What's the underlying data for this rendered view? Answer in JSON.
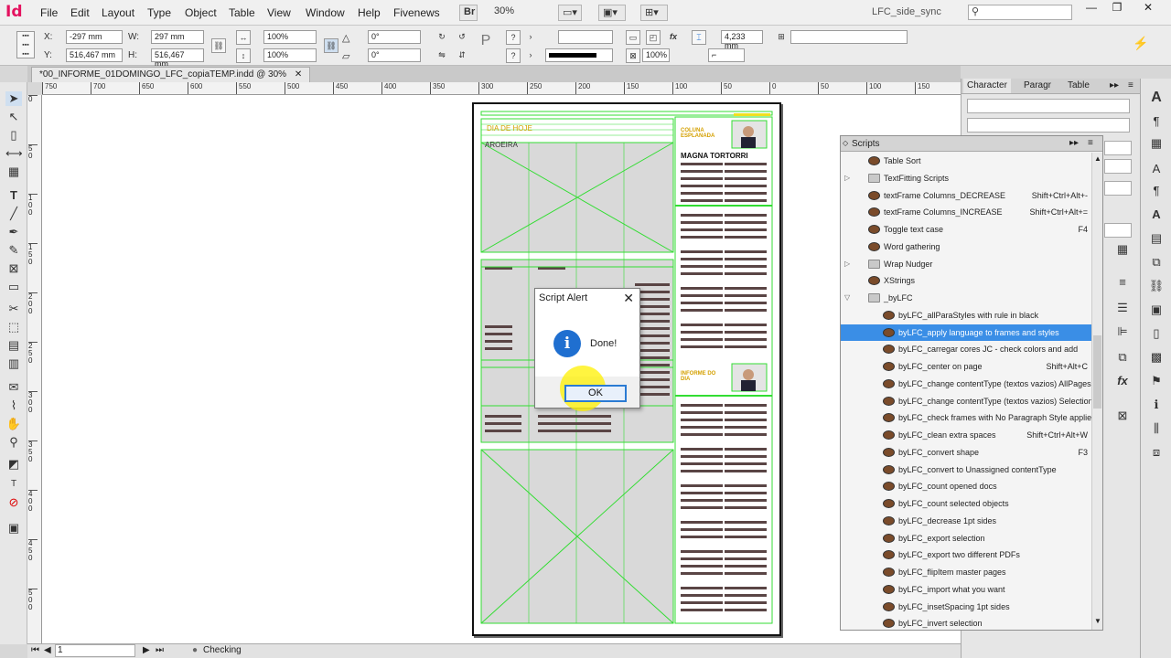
{
  "app": {
    "logo": "Id",
    "workspace": "LFC_side_sync",
    "zoom": "30%",
    "bridge_label": "Br"
  },
  "menu": [
    "File",
    "Edit",
    "Layout",
    "Type",
    "Object",
    "Table",
    "View",
    "Window",
    "Help",
    "Fivenews"
  ],
  "control": {
    "x_label": "X:",
    "x_value": "-297 mm",
    "y_label": "Y:",
    "y_value": "516,467 mm",
    "w_label": "W:",
    "w_value": "297 mm",
    "h_label": "H:",
    "h_value": "516,467 mm",
    "scale_x": "100%",
    "scale_y": "100%",
    "rotate": "0°",
    "shear": "0°",
    "stroke_weight": "4,233 mm",
    "opacity": "100%"
  },
  "doc_tab": "*00_INFORME_01DOMINGO_LFC_copiaTEMP.indd @ 30%",
  "ruler_h": [
    "750",
    "700",
    "650",
    "600",
    "550",
    "500",
    "450",
    "400",
    "350",
    "300",
    "250",
    "200",
    "150",
    "100",
    "50",
    "0",
    "50",
    "100",
    "150"
  ],
  "ruler_v": [
    "0",
    "5 0",
    "1 0 0",
    "1 5 0",
    "2 0 0",
    "2 5 0",
    "3 0 0",
    "3 5 0",
    "4 0 0",
    "4 5 0",
    "5 0 0"
  ],
  "page_texts": {
    "head1": "DIA DE HOJE",
    "head2": "AROEIRA",
    "col_title": "COLUNA ESPLANADA",
    "author": "MAGNA TORTORRI",
    "informe": "INFORME DO DIA"
  },
  "dialog": {
    "title": "Script Alert",
    "message": "Done!",
    "ok": "OK",
    "close": "✕",
    "info": "i"
  },
  "status": {
    "page": "1",
    "preflight": "Checking"
  },
  "char_panel": {
    "tab_character": "Character",
    "tab_paragraph": "Paragr",
    "tab_table": "Table"
  },
  "scripts_panel": {
    "title": "Scripts",
    "items": [
      {
        "label": "Table Sort",
        "shortcut": "",
        "kind": "script",
        "indent": 1,
        "twisty": ""
      },
      {
        "label": "TextFitting Scripts",
        "shortcut": "",
        "kind": "folder",
        "indent": 1,
        "twisty": "▷"
      },
      {
        "label": "textFrame Columns_DECREASE",
        "shortcut": "Shift+Ctrl+Alt+-",
        "kind": "script",
        "indent": 1,
        "twisty": ""
      },
      {
        "label": "textFrame Columns_INCREASE",
        "shortcut": "Shift+Ctrl+Alt+=",
        "kind": "script",
        "indent": 1,
        "twisty": ""
      },
      {
        "label": "Toggle text case",
        "shortcut": "F4",
        "kind": "script",
        "indent": 1,
        "twisty": ""
      },
      {
        "label": "Word gathering",
        "shortcut": "",
        "kind": "script",
        "indent": 1,
        "twisty": ""
      },
      {
        "label": "Wrap Nudger",
        "shortcut": "",
        "kind": "folder",
        "indent": 1,
        "twisty": "▷"
      },
      {
        "label": "XStrings",
        "shortcut": "",
        "kind": "script",
        "indent": 1,
        "twisty": ""
      },
      {
        "label": "_byLFC",
        "shortcut": "",
        "kind": "folder",
        "indent": 1,
        "twisty": "▽"
      },
      {
        "label": "byLFC_allParaStyles with rule in black",
        "shortcut": "",
        "kind": "script",
        "indent": 2,
        "twisty": ""
      },
      {
        "label": "byLFC_apply language to frames and styles",
        "shortcut": "",
        "kind": "script",
        "indent": 2,
        "twisty": "",
        "selected": true
      },
      {
        "label": "byLFC_carregar cores JC - check colors and add",
        "shortcut": "",
        "kind": "script",
        "indent": 2,
        "twisty": ""
      },
      {
        "label": "byLFC_center on page",
        "shortcut": "Shift+Alt+C",
        "kind": "script",
        "indent": 2,
        "twisty": ""
      },
      {
        "label": "byLFC_change contentType (textos vazios) AllPages",
        "shortcut": "",
        "kind": "script",
        "indent": 2,
        "twisty": ""
      },
      {
        "label": "byLFC_change contentType (textos vazios) Selection",
        "shortcut": "",
        "kind": "script",
        "indent": 2,
        "twisty": ""
      },
      {
        "label": "byLFC_check frames with No Paragraph Style applied",
        "shortcut": "",
        "kind": "script",
        "indent": 2,
        "twisty": ""
      },
      {
        "label": "byLFC_clean extra spaces",
        "shortcut": "Shift+Ctrl+Alt+W",
        "kind": "script",
        "indent": 2,
        "twisty": ""
      },
      {
        "label": "byLFC_convert shape",
        "shortcut": "F3",
        "kind": "script",
        "indent": 2,
        "twisty": ""
      },
      {
        "label": "byLFC_convert to Unassigned contentType",
        "shortcut": "",
        "kind": "script",
        "indent": 2,
        "twisty": ""
      },
      {
        "label": "byLFC_count opened docs",
        "shortcut": "",
        "kind": "script",
        "indent": 2,
        "twisty": ""
      },
      {
        "label": "byLFC_count selected objects",
        "shortcut": "",
        "kind": "script",
        "indent": 2,
        "twisty": ""
      },
      {
        "label": "byLFC_decrease 1pt sides",
        "shortcut": "",
        "kind": "script",
        "indent": 2,
        "twisty": ""
      },
      {
        "label": "byLFC_export selection",
        "shortcut": "",
        "kind": "script",
        "indent": 2,
        "twisty": ""
      },
      {
        "label": "byLFC_export two different PDFs",
        "shortcut": "",
        "kind": "script",
        "indent": 2,
        "twisty": ""
      },
      {
        "label": "byLFC_flipItem master pages",
        "shortcut": "",
        "kind": "script",
        "indent": 2,
        "twisty": ""
      },
      {
        "label": "byLFC_import what you want",
        "shortcut": "",
        "kind": "script",
        "indent": 2,
        "twisty": ""
      },
      {
        "label": "byLFC_insetSpacing 1pt sides",
        "shortcut": "",
        "kind": "script",
        "indent": 2,
        "twisty": ""
      },
      {
        "label": "byLFC_invert selection",
        "shortcut": "",
        "kind": "script",
        "indent": 2,
        "twisty": ""
      }
    ]
  },
  "colors": {
    "selection": "#3a8ee6",
    "frame_green": "#33dd33",
    "info_blue": "#1f6fd0",
    "highlight": "#fff000",
    "logo": "#e4125f"
  }
}
